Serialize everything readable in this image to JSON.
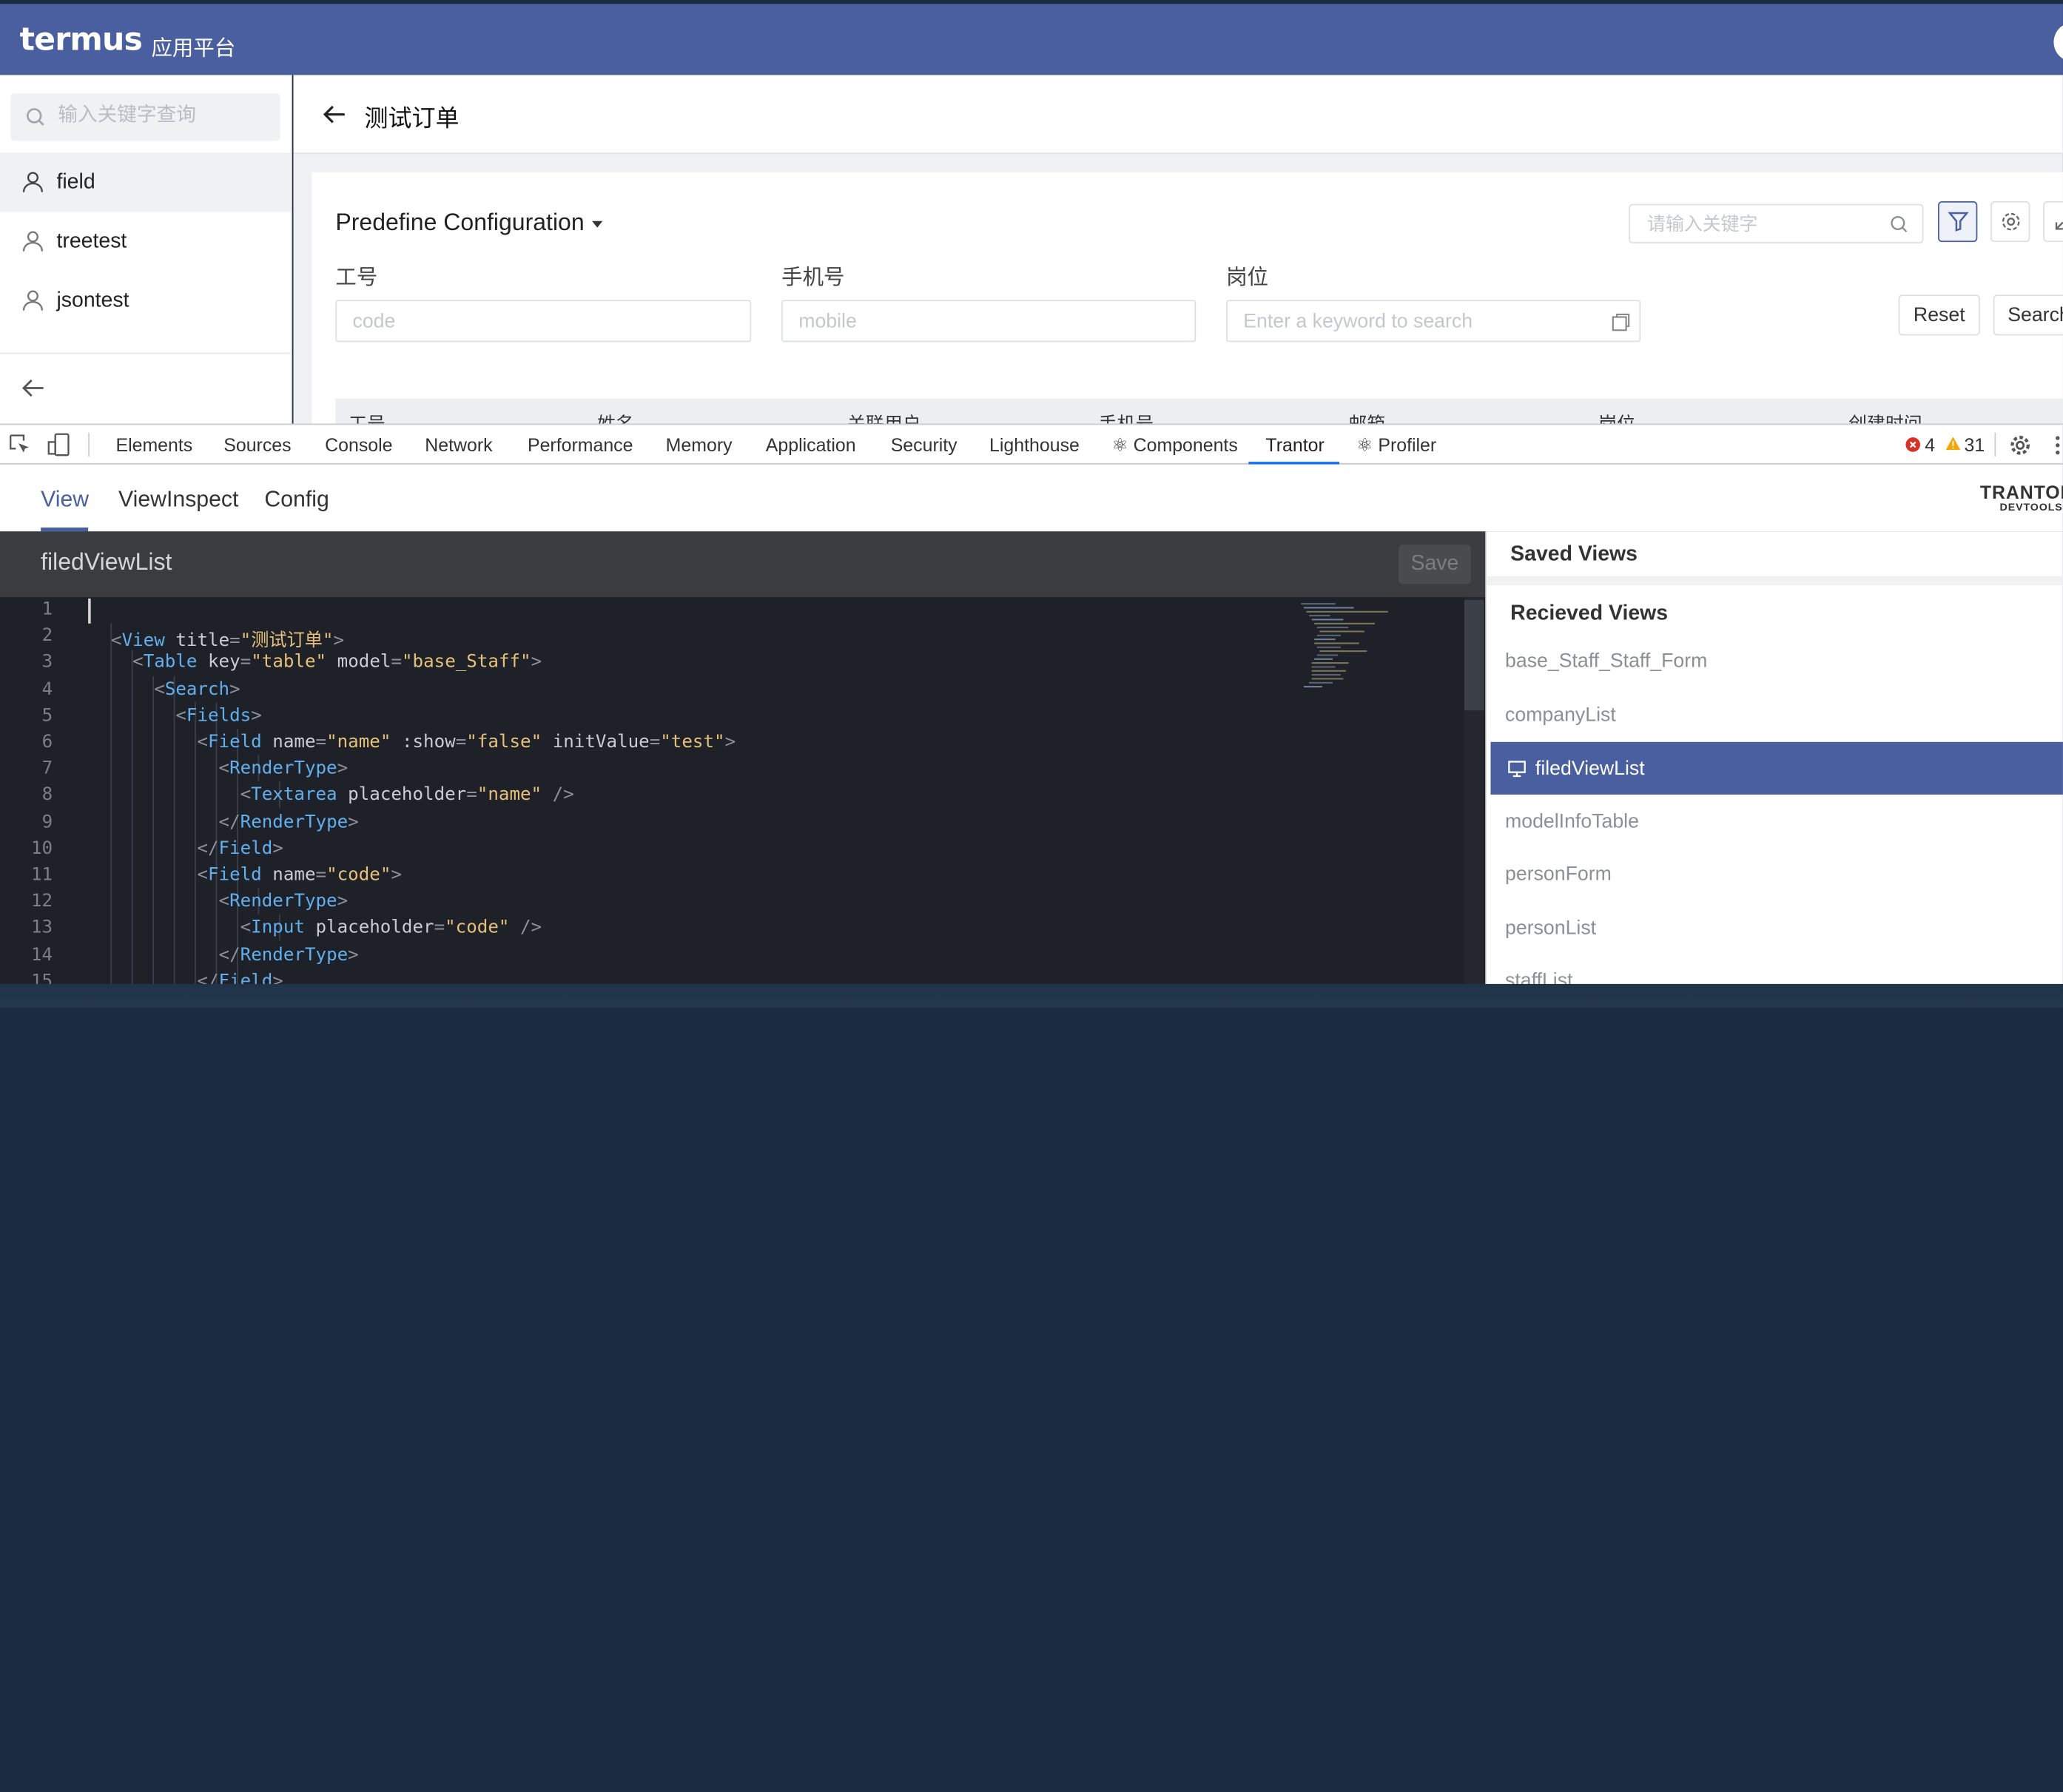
{
  "app": {
    "logo": "termus",
    "subtitle": "应用平台"
  },
  "sidebar": {
    "search_placeholder": "输入关键字查询",
    "items": [
      {
        "label": "field",
        "active": true
      },
      {
        "label": "treetest"
      },
      {
        "label": "jsontest"
      }
    ]
  },
  "page": {
    "title": "测试订单",
    "config_label": "Predefine Configuration",
    "keyword_placeholder": "请输入关键字",
    "filters": [
      {
        "label": "工号",
        "placeholder": "code"
      },
      {
        "label": "手机号",
        "placeholder": "mobile"
      },
      {
        "label": "岗位",
        "placeholder": "Enter a keyword to search"
      }
    ],
    "reset_label": "Reset",
    "search_label": "Search",
    "table_headers": [
      "工号",
      "姓名",
      "关联用户",
      "手机号",
      "邮箱",
      "岗位",
      "创建时间"
    ]
  },
  "devtools": {
    "tabs": [
      "Elements",
      "Sources",
      "Console",
      "Network",
      "Performance",
      "Memory",
      "Application",
      "Security",
      "Lighthouse",
      "⚛ Components",
      "Trantor",
      "⚛ Profiler"
    ],
    "active_tab": "Trantor",
    "errors": "4",
    "warnings": "31"
  },
  "trantor": {
    "tabs": [
      "View",
      "ViewInspect",
      "Config"
    ],
    "active_tab": "View",
    "brand": "TRANTOR",
    "brand_sub": "DEVTOOLS",
    "editor_title": "filedViewList",
    "save_label": "Save",
    "code_lines": [
      "",
      "  <View title=\"测试订单\">",
      "    <Table key=\"table\" model=\"base_Staff\">",
      "      <Search>",
      "        <Fields>",
      "          <Field name=\"name\" :show=\"false\" initValue=\"test\">",
      "            <RenderType>",
      "              <Textarea placeholder=\"name\" />",
      "            </RenderType>",
      "          </Field>",
      "          <Field name=\"code\">",
      "            <RenderType>",
      "              <Input placeholder=\"code\" />",
      "            </RenderType>",
      "          </Field>"
    ],
    "saved_views_title": "Saved Views",
    "received_views_title": "Recieved Views",
    "received_views": [
      "base_Staff_Staff_Form",
      "companyList",
      "filedViewList",
      "modelInfoTable",
      "personForm",
      "personList",
      "staffList"
    ],
    "selected_view": "filedViewList"
  }
}
